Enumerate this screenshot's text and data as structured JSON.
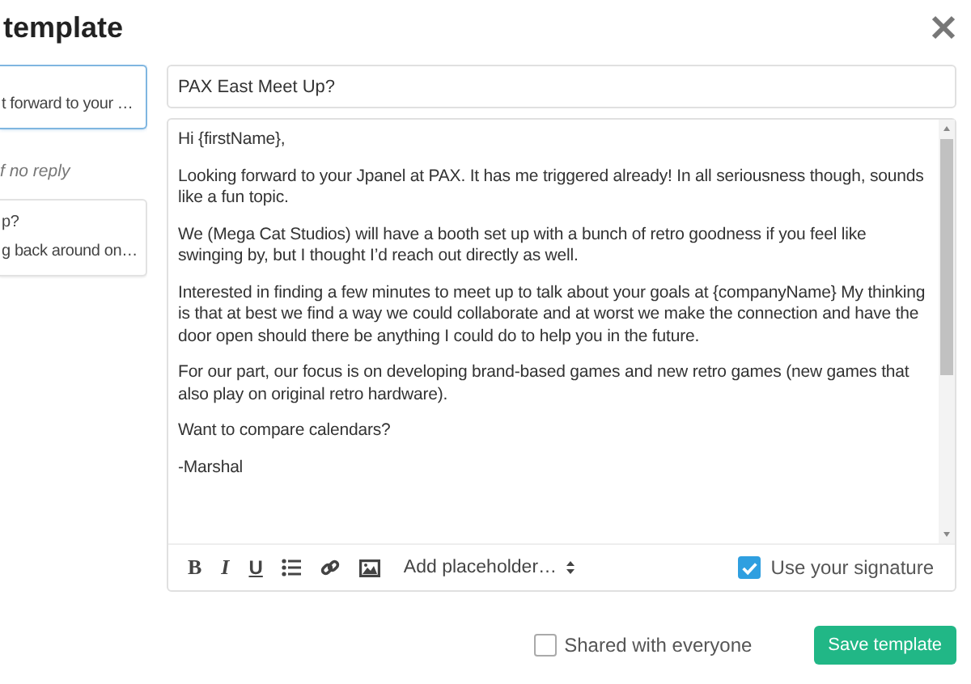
{
  "title": "template",
  "templates": [
    {
      "lines": [
        "t forward to your …"
      ],
      "selected": true
    },
    {
      "lines": [
        "p?",
        "g back around on…"
      ],
      "selected": false
    }
  ],
  "follow_up_label": "f no reply",
  "subject": "PAX East Meet Up?",
  "body": [
    "Hi {firstName},",
    "Looking forward to your Jpanel at PAX. It has me triggered already! In all seriousness though, sounds like a fun topic.",
    "We (Mega Cat Studios) will have a booth set up with a bunch of retro goodness if you feel like swinging by, but I thought I’d reach out directly as well.",
    "Interested in finding a few minutes to meet up to talk about your goals at {companyName} My thinking is that at best we find a way we could collaborate and at worst we make the connection and have the door open should there be anything I could do to help you in the future.",
    "For our part, our focus is on developing brand-based games and new retro games (new games that also play on original retro hardware).",
    "Want to compare calendars?",
    "-Marshal"
  ],
  "format_buttons": [
    {
      "label": "B",
      "kind": "bold"
    },
    {
      "label": "I",
      "kind": "italic"
    },
    {
      "label": "U",
      "kind": "underline"
    }
  ],
  "placeholder_menu": "Add placeholder…",
  "use_signature": {
    "label": "Use your signature",
    "checked": true
  },
  "shared": {
    "label": "Shared with everyone",
    "checked": false
  },
  "save_button": "Save template"
}
